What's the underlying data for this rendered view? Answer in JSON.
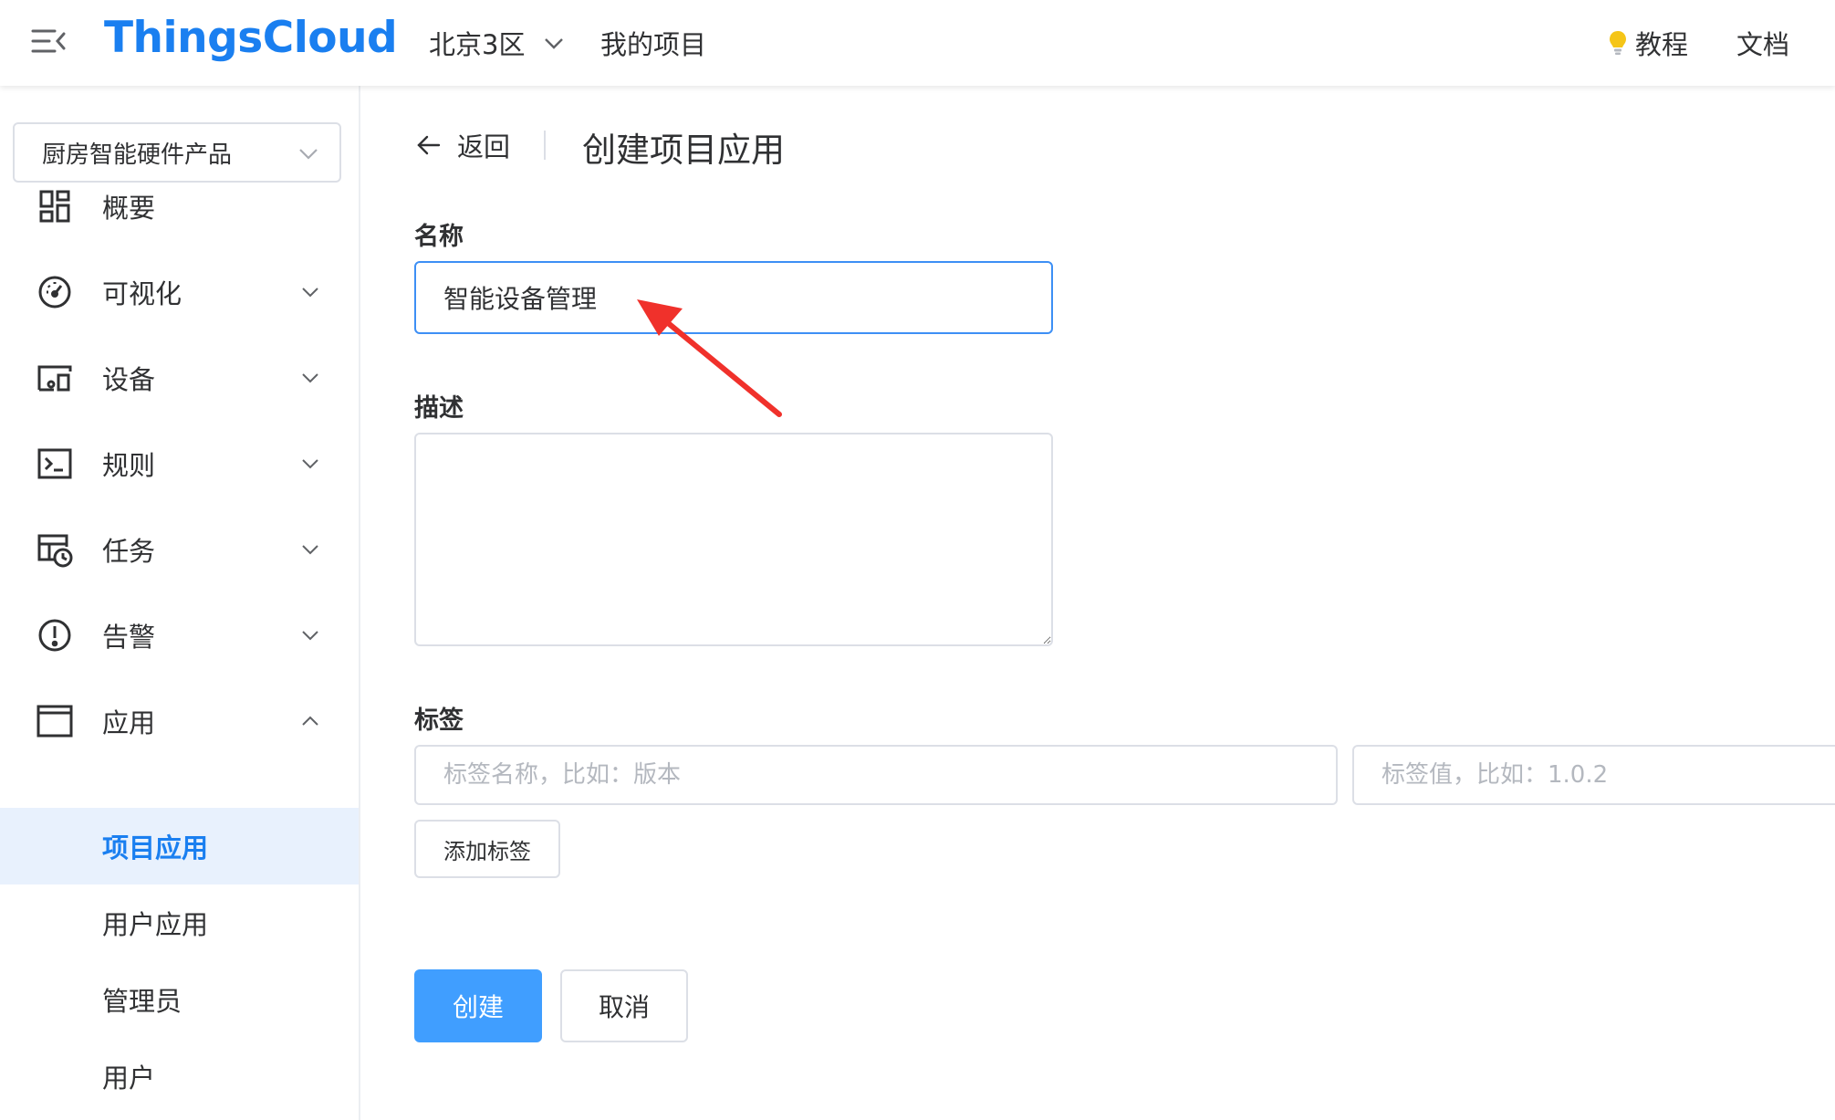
{
  "header": {
    "logo": "ThingsCloud",
    "region": "北京3区",
    "my_projects": "我的项目",
    "tutorial": "教程",
    "docs": "文档"
  },
  "sidebar": {
    "project_select": "厨房智能硬件产品",
    "items": [
      {
        "label": "概要",
        "icon": "dashboard-grid-icon",
        "expandable": false
      },
      {
        "label": "可视化",
        "icon": "gauge-icon",
        "expandable": true
      },
      {
        "label": "设备",
        "icon": "device-icon",
        "expandable": true
      },
      {
        "label": "规则",
        "icon": "terminal-icon",
        "expandable": true
      },
      {
        "label": "任务",
        "icon": "calendar-clock-icon",
        "expandable": true
      },
      {
        "label": "告警",
        "icon": "alert-circle-icon",
        "expandable": true
      },
      {
        "label": "应用",
        "icon": "window-icon",
        "expandable": true,
        "expanded": true
      }
    ],
    "sub_items": [
      {
        "label": "项目应用",
        "active": true
      },
      {
        "label": "用户应用",
        "active": false
      },
      {
        "label": "管理员",
        "active": false
      },
      {
        "label": "用户",
        "active": false
      }
    ]
  },
  "main": {
    "back_label": "返回",
    "title": "创建项目应用",
    "name_label": "名称",
    "name_value": "智能设备管理",
    "description_label": "描述",
    "description_value": "",
    "tags_label": "标签",
    "tag_name_placeholder": "标签名称，比如：版本",
    "tag_value_placeholder": "标签值，比如：1.0.2",
    "add_tag_label": "添加标签",
    "create_label": "创建",
    "cancel_label": "取消"
  },
  "colors": {
    "brand": "#1a7ff0",
    "primary_button": "#409eff",
    "active_bg": "#e8f1fd",
    "annotation_arrow": "#f0312b"
  }
}
